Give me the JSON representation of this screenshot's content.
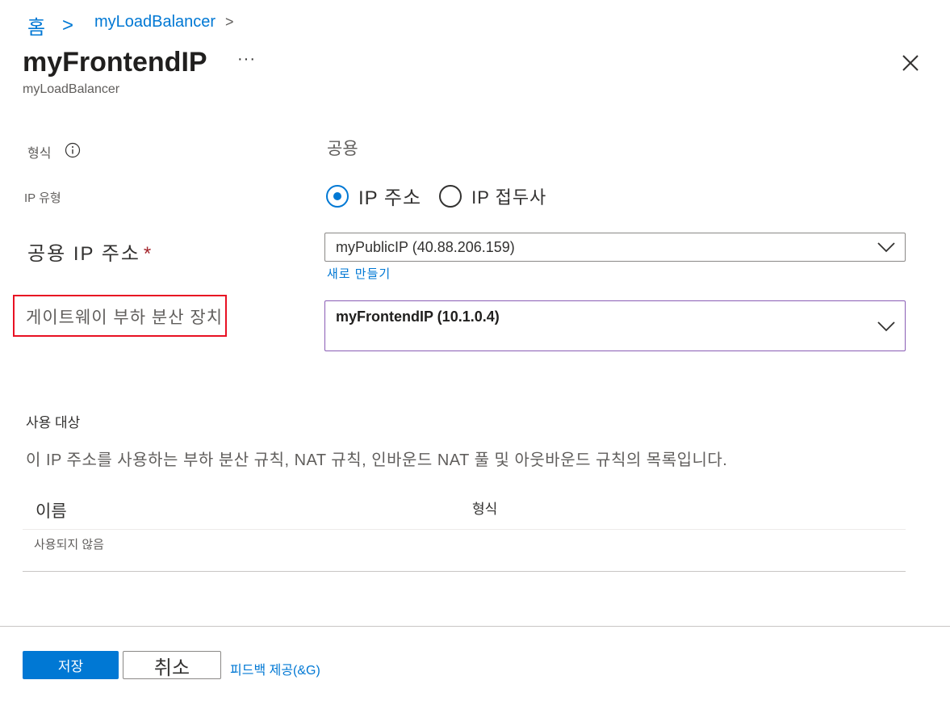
{
  "breadcrumb": {
    "home": "홈",
    "sep": ">",
    "current": "myLoadBalancer",
    "chevron": ">"
  },
  "header": {
    "title": "myFrontendIP",
    "more": "···",
    "subtitle": "myLoadBalancer"
  },
  "form": {
    "type": {
      "label": "형식",
      "value": "공용"
    },
    "ip_type": {
      "label": "IP 유형",
      "options": [
        {
          "label": "IP 주소",
          "selected": true
        },
        {
          "label": "IP 접두사",
          "selected": false
        }
      ]
    },
    "public_ip": {
      "label": "공용 IP 주소",
      "required": "*",
      "value": "myPublicIP (40.88.206.159)",
      "create_new": "새로 만들기"
    },
    "gateway_lb": {
      "label": "게이트웨이 부하 분산 장치",
      "value": "myFrontendIP (10.1.0.4)"
    }
  },
  "usage": {
    "title": "사용 대상",
    "description": "이 IP 주소를 사용하는 부하 분산 규칙, NAT 규칙, 인바운드 NAT 풀 및 아웃바운드 규칙의 목록입니다.",
    "columns": [
      "이름",
      "형식"
    ],
    "empty": "사용되지 않음"
  },
  "footer": {
    "save": "저장",
    "cancel": "취소",
    "feedback": "피드백 제공(&G)"
  },
  "colors": {
    "accent": "#0078d4",
    "highlight": "#e81123"
  },
  "icons": {
    "close": "close-icon",
    "info": "info-icon",
    "chevron": "chevron-down-icon"
  }
}
